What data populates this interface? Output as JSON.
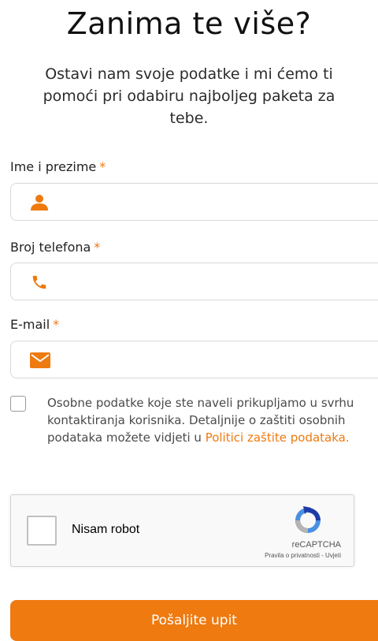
{
  "header": {
    "title": "Zanima te više?",
    "subtitle": "Ostavi nam svoje podatke i mi ćemo ti pomoći pri odabiru najboljeg paketa za tebe."
  },
  "form": {
    "required_marker": "*",
    "fields": [
      {
        "label": "Ime i prezime",
        "icon": "person-icon",
        "value": ""
      },
      {
        "label": "Broj telefona",
        "icon": "phone-icon",
        "value": ""
      },
      {
        "label": "E-mail",
        "icon": "envelope-icon",
        "value": ""
      }
    ],
    "consent": {
      "checked": false,
      "text": "Osobne podatke koje ste naveli prikupljamo u svrhu kontaktiranja korisnika. Detaljnije o zaštiti osobnih podataka možete vidjeti u ",
      "link_text": "Politici zaštite podataka."
    },
    "captcha": {
      "label": "Nisam robot",
      "brand": "reCAPTCHA",
      "terms": "Pravila o privatnosti - Uvjeti"
    },
    "submit_label": "Pošaljite upit"
  },
  "colors": {
    "accent": "#ee7a10",
    "border": "#d9d9d9",
    "text": "#222222"
  }
}
